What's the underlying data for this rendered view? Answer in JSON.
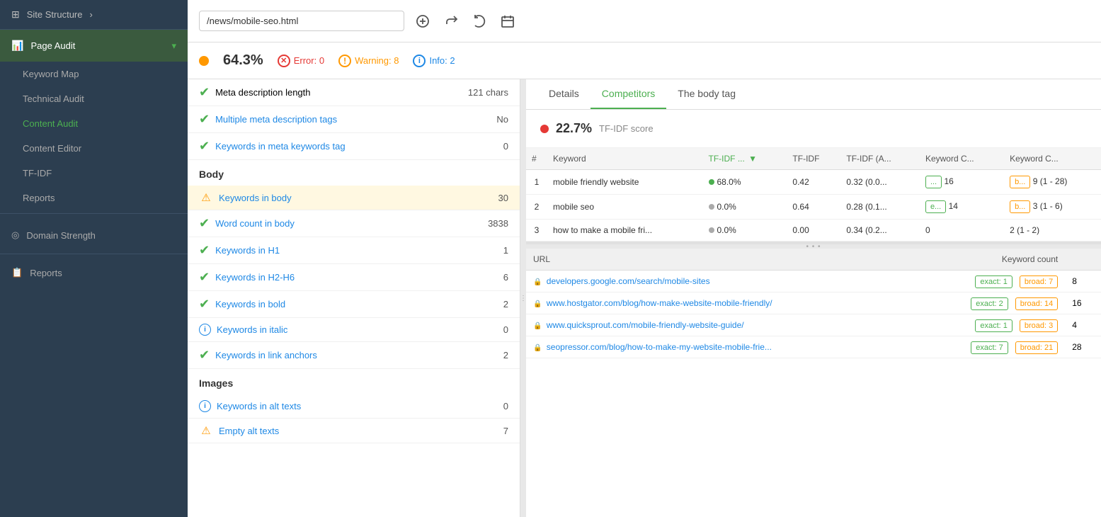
{
  "sidebar": {
    "site_structure_label": "Site Structure",
    "page_audit_label": "Page Audit",
    "items": [
      {
        "id": "keyword-map",
        "label": "Keyword Map",
        "active": false
      },
      {
        "id": "technical-audit",
        "label": "Technical Audit",
        "active": false
      },
      {
        "id": "content-audit",
        "label": "Content Audit",
        "active": true,
        "color": "green"
      },
      {
        "id": "content-editor",
        "label": "Content Editor",
        "active": false
      },
      {
        "id": "tfidf",
        "label": "TF-IDF",
        "active": false
      },
      {
        "id": "reports",
        "label": "Reports",
        "active": false
      }
    ],
    "domain_strength_label": "Domain Strength",
    "reports_label": "Reports"
  },
  "toolbar": {
    "url_value": "/news/mobile-seo.html",
    "url_placeholder": "/news/mobile-seo.html"
  },
  "statusbar": {
    "score": "64.3%",
    "error_label": "Error: 0",
    "warning_label": "Warning: 8",
    "info_label": "Info: 2"
  },
  "left_panel": {
    "meta_description_length_label": "Meta description length",
    "meta_description_length_value": "121 chars",
    "multiple_meta_label": "Multiple meta description tags",
    "multiple_meta_value": "No",
    "keywords_meta_keywords_label": "Keywords in meta keywords tag",
    "keywords_meta_keywords_value": "0",
    "body_section_label": "Body",
    "keywords_body_label": "Keywords in body",
    "keywords_body_value": "30",
    "word_count_label": "Word count in body",
    "word_count_value": "3838",
    "keywords_h1_label": "Keywords in H1",
    "keywords_h1_value": "1",
    "keywords_h2h6_label": "Keywords in H2-H6",
    "keywords_h2h6_value": "6",
    "keywords_bold_label": "Keywords in bold",
    "keywords_bold_value": "2",
    "keywords_italic_label": "Keywords in italic",
    "keywords_italic_value": "0",
    "keywords_link_label": "Keywords in link anchors",
    "keywords_link_value": "2",
    "images_section_label": "Images",
    "keywords_alt_label": "Keywords in alt texts",
    "keywords_alt_value": "0",
    "empty_alt_label": "Empty alt texts",
    "empty_alt_value": "7"
  },
  "right_panel": {
    "tabs": [
      {
        "id": "details",
        "label": "Details"
      },
      {
        "id": "competitors",
        "label": "Competitors",
        "active": true
      },
      {
        "id": "body-tag",
        "label": "The body tag"
      }
    ],
    "score_value": "22.7%",
    "score_label": "TF-IDF score",
    "table_headers": {
      "num": "#",
      "keyword": "Keyword",
      "tfidf_sort": "TF-IDF ...",
      "tfidf": "TF-IDF",
      "tfidf_avg": "TF-IDF (A...",
      "keyword_c1": "Keyword C...",
      "keyword_c2": "Keyword C..."
    },
    "rows": [
      {
        "num": "1",
        "keyword": "mobile friendly website",
        "tfidf_pct": "68.0%",
        "dot": "green",
        "tfidf": "0.42",
        "tfidf_avg": "0.32 (0.0...",
        "kw_c1": "...",
        "kw_c1_color": "green",
        "kw_c2": "b...",
        "kw_c2_color": "orange",
        "count": "16",
        "range": "9 (1 - 28)"
      },
      {
        "num": "2",
        "keyword": "mobile seo",
        "tfidf_pct": "0.0%",
        "dot": "grey",
        "tfidf": "0.64",
        "tfidf_avg": "0.28 (0.1...",
        "kw_c1": "e...",
        "kw_c1_color": "green",
        "kw_c2": "b...",
        "kw_c2_color": "orange",
        "count": "14",
        "range": "3 (1 - 6)"
      },
      {
        "num": "3",
        "keyword": "how to make a mobile fri...",
        "tfidf_pct": "0.0%",
        "dot": "grey",
        "tfidf": "0.00",
        "tfidf_avg": "0.34 (0.2...",
        "kw_c1": "",
        "kw_c1_color": "",
        "kw_c2": "",
        "kw_c2_color": "",
        "count": "0",
        "range": "2 (1 - 2)"
      }
    ],
    "url_table_headers": {
      "url": "URL",
      "keyword_count": "Keyword count"
    },
    "url_rows": [
      {
        "url": "developers.google.com/search/mobile-sites",
        "exact_label": "exact: 1",
        "broad_label": "broad: 7",
        "count": "8"
      },
      {
        "url": "www.hostgator.com/blog/how-make-website-mobile-friendly/",
        "exact_label": "exact: 2",
        "broad_label": "broad: 14",
        "count": "16"
      },
      {
        "url": "www.quicksprout.com/mobile-friendly-website-guide/",
        "exact_label": "exact: 1",
        "broad_label": "broad: 3",
        "count": "4"
      },
      {
        "url": "seopressor.com/blog/how-to-make-my-website-mobile-frie...",
        "exact_label": "exact: 7",
        "broad_label": "broad: 21",
        "count": "28"
      }
    ]
  }
}
